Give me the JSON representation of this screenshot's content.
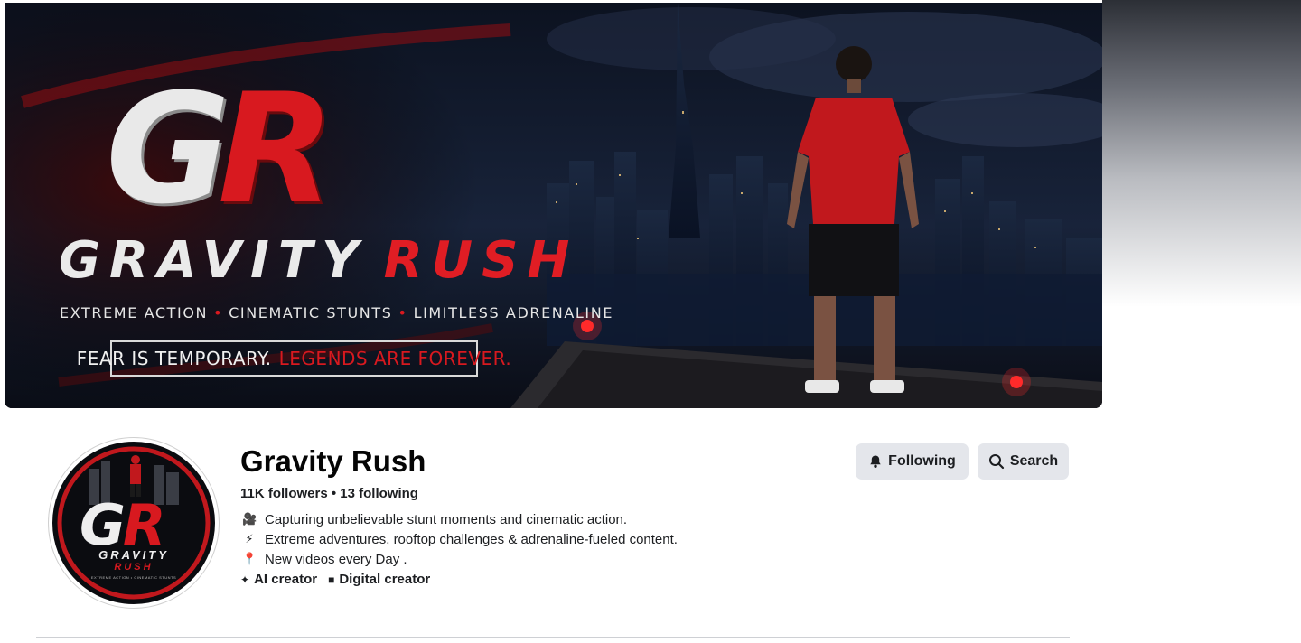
{
  "cover": {
    "logo_letters_1": "G",
    "logo_letters_2": "R",
    "title_word_1": "GRAVITY",
    "title_word_2": "RUSH",
    "tagline": [
      "EXTREME ACTION",
      "CINEMATIC STUNTS",
      "LIMITLESS ADRENALINE"
    ],
    "tagline_separator": "•",
    "motto_part_1": "FEAR IS TEMPORARY.",
    "motto_part_2": "LEGENDS ARE FOREVER."
  },
  "avatar": {
    "letters_1": "G",
    "letters_2": "R",
    "word_1": "GRAVITY",
    "word_2": "RUSH",
    "small_text": "EXTREME ACTION • CINEMATIC STUNTS"
  },
  "profile": {
    "name": "Gravity Rush",
    "stats": "11K followers • 13 following",
    "bio": [
      {
        "icon": "movie-camera-icon",
        "glyph": "🎥",
        "text": "Capturing unbelievable stunt moments and cinematic action."
      },
      {
        "icon": "lightning-icon",
        "glyph": "⚡",
        "text": "Extreme adventures, rooftop challenges & adrenaline-fueled content."
      },
      {
        "icon": "pin-icon",
        "glyph": "📍",
        "text": "New videos every Day ."
      }
    ],
    "categories": [
      {
        "icon": "sparkle-icon",
        "glyph": "✦",
        "label": "AI creator"
      },
      {
        "icon": "briefcase-icon",
        "glyph": "■",
        "label": "Digital creator"
      }
    ]
  },
  "actions": {
    "following_label": "Following",
    "search_label": "Search"
  },
  "colors": {
    "accent_red": "#d8191f",
    "button_bg": "#e4e6eb",
    "text": "#050505"
  }
}
